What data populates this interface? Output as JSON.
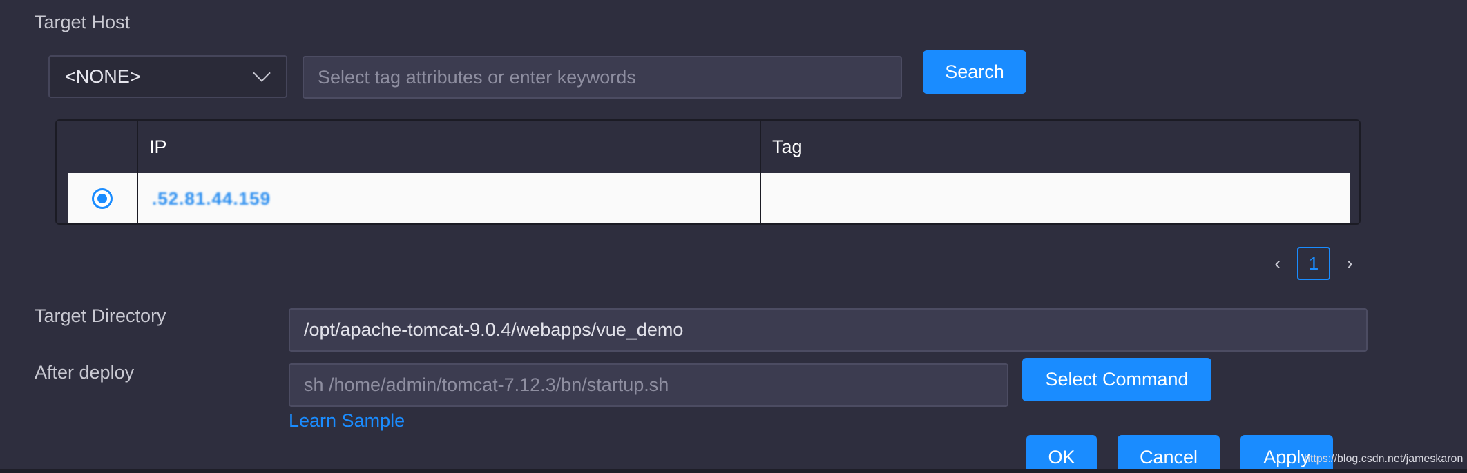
{
  "target_host": {
    "label": "Target Host",
    "select_value": "<NONE>",
    "search_placeholder": "Select tag attributes or enter keywords",
    "search_button": "Search"
  },
  "table": {
    "columns": [
      "",
      "IP",
      "Tag"
    ],
    "rows": [
      {
        "selected": true,
        "ip": ".52.81.44.159",
        "tag": ""
      }
    ]
  },
  "pagination": {
    "prev_icon": "chevron-left-icon",
    "current_page": "1",
    "next_icon": "chevron-right-icon"
  },
  "target_directory": {
    "label": "Target Directory",
    "value": "/opt/apache-tomcat-9.0.4/webapps/vue_demo"
  },
  "after_deploy": {
    "label": "After deploy",
    "placeholder": "sh /home/admin/tomcat-7.12.3/bn/startup.sh",
    "select_command_button": "Select Command",
    "learn_sample_link": "Learn Sample"
  },
  "footer": {
    "ok_button": "OK",
    "cancel_button": "Cancel",
    "apply_button": "Apply"
  },
  "watermark": "https://blog.csdn.net/jameskaron",
  "colors": {
    "background": "#2e2e3e",
    "accent": "#1a8cff",
    "input_bg": "#3c3c50"
  }
}
